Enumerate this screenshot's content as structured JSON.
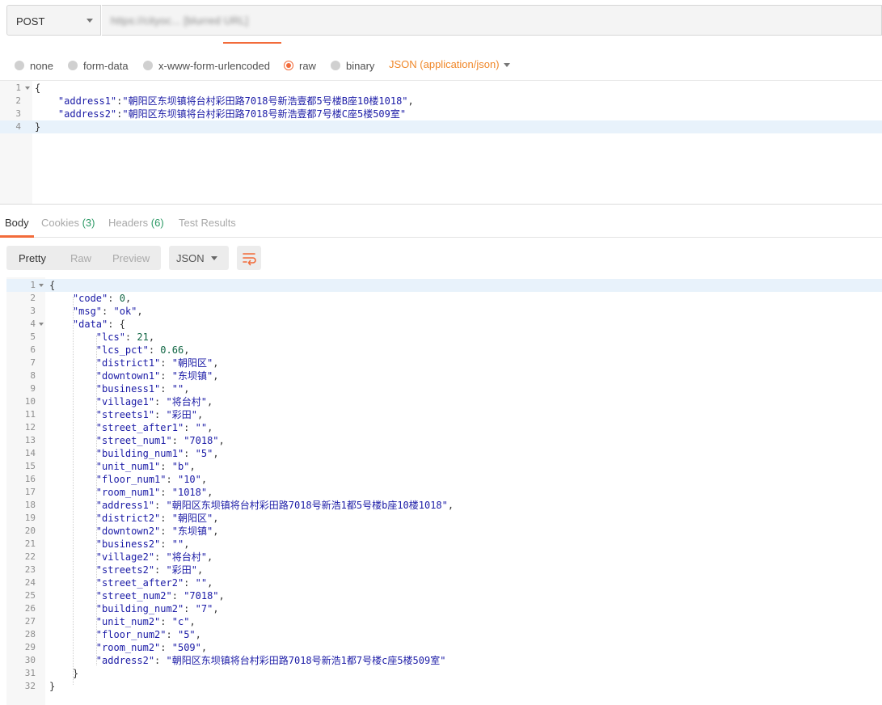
{
  "request": {
    "method": "POST",
    "url": "https://cityoc... [blurred URL]"
  },
  "body_types": {
    "options": [
      "none",
      "form-data",
      "x-www-form-urlencoded",
      "raw",
      "binary"
    ],
    "selected": "raw",
    "content_type": "JSON (application/json)"
  },
  "request_body": {
    "lines": [
      {
        "num": "1",
        "text": "{"
      },
      {
        "num": "2",
        "text": "    \"address1\":\"朝阳区东坝镇将台村彩田路7018号新浩壹都5号楼B座10楼1018\","
      },
      {
        "num": "3",
        "text": "    \"address2\":\"朝阳区东坝镇将台村彩田路7018号新浩壹都7号楼C座5楼509室\""
      },
      {
        "num": "4",
        "text": "}"
      }
    ]
  },
  "response_tabs": {
    "body": "Body",
    "cookies": "Cookies",
    "cookies_count": "(3)",
    "headers": "Headers",
    "headers_count": "(6)",
    "test_results": "Test Results"
  },
  "response_toolbar": {
    "pretty": "Pretty",
    "raw": "Raw",
    "preview": "Preview",
    "format": "JSON"
  },
  "response_body": {
    "lines": [
      {
        "num": "1",
        "text": "{"
      },
      {
        "num": "2",
        "text": "    \"code\": 0,"
      },
      {
        "num": "3",
        "text": "    \"msg\": \"ok\","
      },
      {
        "num": "4",
        "text": "    \"data\": {"
      },
      {
        "num": "5",
        "text": "        \"lcs\": 21,"
      },
      {
        "num": "6",
        "text": "        \"lcs_pct\": 0.66,"
      },
      {
        "num": "7",
        "text": "        \"district1\": \"朝阳区\","
      },
      {
        "num": "8",
        "text": "        \"downtown1\": \"东坝镇\","
      },
      {
        "num": "9",
        "text": "        \"business1\": \"\","
      },
      {
        "num": "10",
        "text": "        \"village1\": \"将台村\","
      },
      {
        "num": "11",
        "text": "        \"streets1\": \"彩田\","
      },
      {
        "num": "12",
        "text": "        \"street_after1\": \"\","
      },
      {
        "num": "13",
        "text": "        \"street_num1\": \"7018\","
      },
      {
        "num": "14",
        "text": "        \"building_num1\": \"5\","
      },
      {
        "num": "15",
        "text": "        \"unit_num1\": \"b\","
      },
      {
        "num": "16",
        "text": "        \"floor_num1\": \"10\","
      },
      {
        "num": "17",
        "text": "        \"room_num1\": \"1018\","
      },
      {
        "num": "18",
        "text": "        \"address1\": \"朝阳区东坝镇将台村彩田路7018号新浩1都5号楼b座10楼1018\","
      },
      {
        "num": "19",
        "text": "        \"district2\": \"朝阳区\","
      },
      {
        "num": "20",
        "text": "        \"downtown2\": \"东坝镇\","
      },
      {
        "num": "21",
        "text": "        \"business2\": \"\","
      },
      {
        "num": "22",
        "text": "        \"village2\": \"将台村\","
      },
      {
        "num": "23",
        "text": "        \"streets2\": \"彩田\","
      },
      {
        "num": "24",
        "text": "        \"street_after2\": \"\","
      },
      {
        "num": "25",
        "text": "        \"street_num2\": \"7018\","
      },
      {
        "num": "26",
        "text": "        \"building_num2\": \"7\","
      },
      {
        "num": "27",
        "text": "        \"unit_num2\": \"c\","
      },
      {
        "num": "28",
        "text": "        \"floor_num2\": \"5\","
      },
      {
        "num": "29",
        "text": "        \"room_num2\": \"509\","
      },
      {
        "num": "30",
        "text": "        \"address2\": \"朝阳区东坝镇将台村彩田路7018号新浩1都7号楼c座5楼509室\""
      },
      {
        "num": "31",
        "text": "    }"
      },
      {
        "num": "32",
        "text": "}"
      }
    ]
  },
  "colors": {
    "accent": "#f26b3a",
    "content_type": "#f0882a",
    "json_key": "#1a1aa6",
    "json_number": "#116644",
    "count_green": "#2e9a67"
  }
}
